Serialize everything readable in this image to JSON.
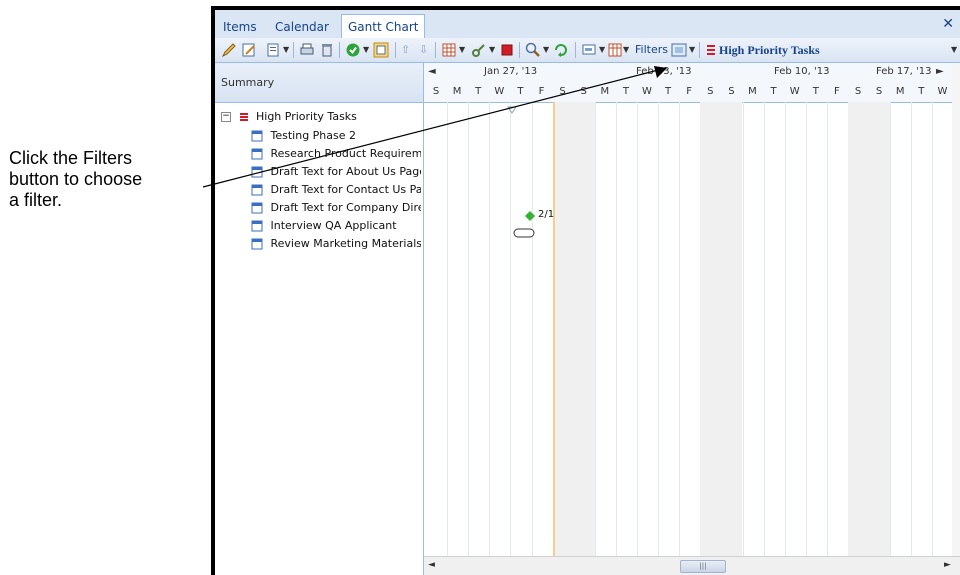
{
  "callout": {
    "line1": "Click the Filters",
    "line2": "button to choose",
    "line3": "a filter."
  },
  "tabs": [
    {
      "label": "Items",
      "active": false
    },
    {
      "label": "Calendar",
      "active": false
    },
    {
      "label": "Gantt Chart",
      "active": true
    }
  ],
  "close_label": "✕",
  "toolbar": {
    "filters_label": "Filters",
    "current_filter": "High Priority Tasks",
    "icons": [
      "pencil-icon",
      "edit-task-icon",
      "new-item-icon",
      "print-icon",
      "delete-icon",
      "complete-icon",
      "view-icon",
      "move-up-icon",
      "move-down-icon",
      "grid-icon",
      "link-icon",
      "stop-icon",
      "zoom-icon",
      "refresh-icon",
      "baseline-icon",
      "columns-icon",
      "filter-icon"
    ]
  },
  "summary_label": "Summary",
  "tree": {
    "root": "High Priority Tasks",
    "items": [
      "Testing Phase 2",
      "Research Product Requireme",
      "Draft Text for About Us Page",
      "Draft Text for Contact Us Pag",
      "Draft Text for Company Direc",
      "Interview QA Applicant",
      "Review Marketing Materials"
    ]
  },
  "gantt": {
    "weeks": [
      "Jan 27, '13",
      "Feb 03, '13",
      "Feb 10, '13",
      "Feb 17, '13"
    ],
    "days": [
      "S",
      "M",
      "T",
      "W",
      "T",
      "F",
      "S",
      "S",
      "M",
      "T",
      "W",
      "T",
      "F",
      "S",
      "S",
      "M",
      "T",
      "W",
      "T",
      "F",
      "S",
      "S",
      "M",
      "T",
      "W"
    ],
    "milestone_label": "2/1",
    "scroll_left": "◄",
    "scroll_right": "►",
    "grip": "|||"
  },
  "colors": {
    "accent": "#15428b",
    "today_line": "#f5c26b",
    "milestone": "#32b432",
    "priority_red": "#d01c2a"
  }
}
